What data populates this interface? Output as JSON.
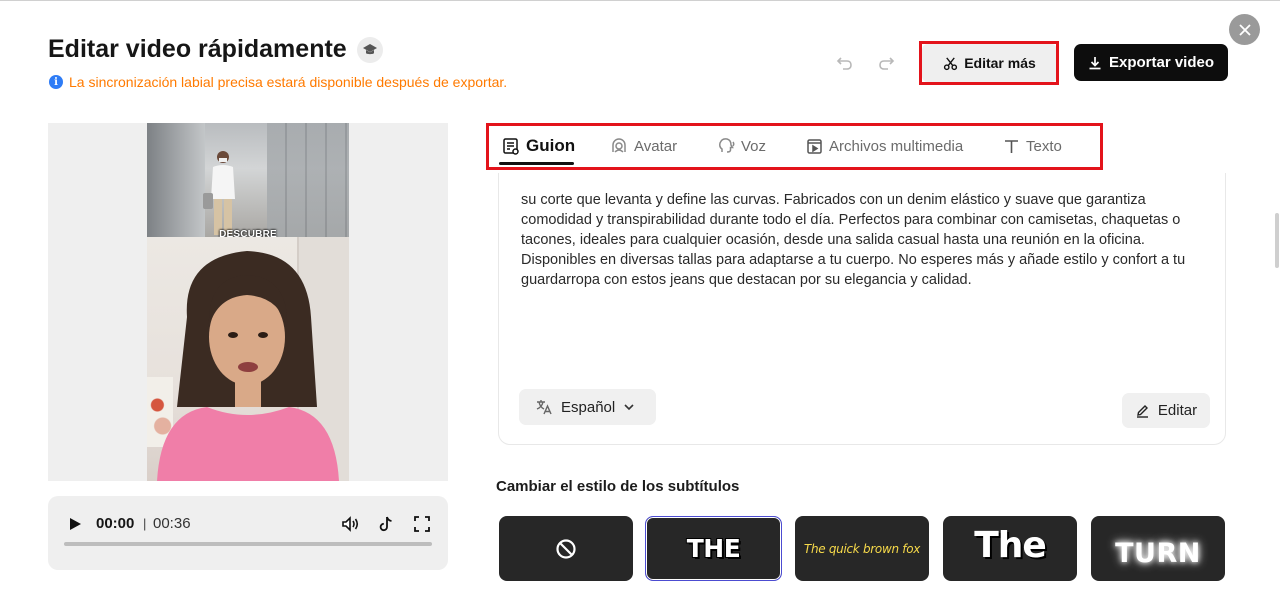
{
  "header": {
    "title": "Editar video rápidamente",
    "notice": "La sincronización labial precisa estará disponible después de exportar.",
    "info_glyph": "i",
    "edit_more_label": "Editar más",
    "export_label": "Exportar video"
  },
  "video": {
    "overlay_text": "DESCUBRE"
  },
  "player": {
    "current_time": "00:00",
    "separator": "|",
    "duration": "00:36",
    "progress": 0
  },
  "tabs": [
    {
      "label": "Guion",
      "icon": "script-icon",
      "active": true
    },
    {
      "label": "Avatar",
      "icon": "avatar-icon",
      "active": false
    },
    {
      "label": "Voz",
      "icon": "voice-icon",
      "active": false
    },
    {
      "label": "Archivos multimedia",
      "icon": "media-icon",
      "active": false
    },
    {
      "label": "Texto",
      "icon": "text-icon",
      "active": false
    }
  ],
  "script": {
    "text": "su corte que levanta y define las curvas. Fabricados con un denim elástico y suave que garantiza comodidad y transpirabilidad durante todo el día. Perfectos para combinar con camisetas, chaquetas o tacones, ideales para cualquier ocasión, desde una salida casual hasta una reunión en la oficina. Disponibles en diversas tallas para adaptarse a tu cuerpo. No esperes más y añade estilo y confort a tu guardarropa con estos jeans que destacan por su elegancia y calidad.",
    "language": "Español",
    "edit_label": "Editar"
  },
  "subtitles": {
    "heading": "Cambiar el estilo de los subtítulos",
    "styles": [
      {
        "sample": ""
      },
      {
        "sample": "THE"
      },
      {
        "sample": "The quick brown fox"
      },
      {
        "sample": "The"
      },
      {
        "sample": "TURN"
      }
    ],
    "selected_index": 1
  },
  "colors": {
    "accent_notice": "#ff7a00",
    "highlight_outline": "#e3131b",
    "primary_button": "#0d0d0d",
    "selected_style_border": "#4c4cd1"
  }
}
